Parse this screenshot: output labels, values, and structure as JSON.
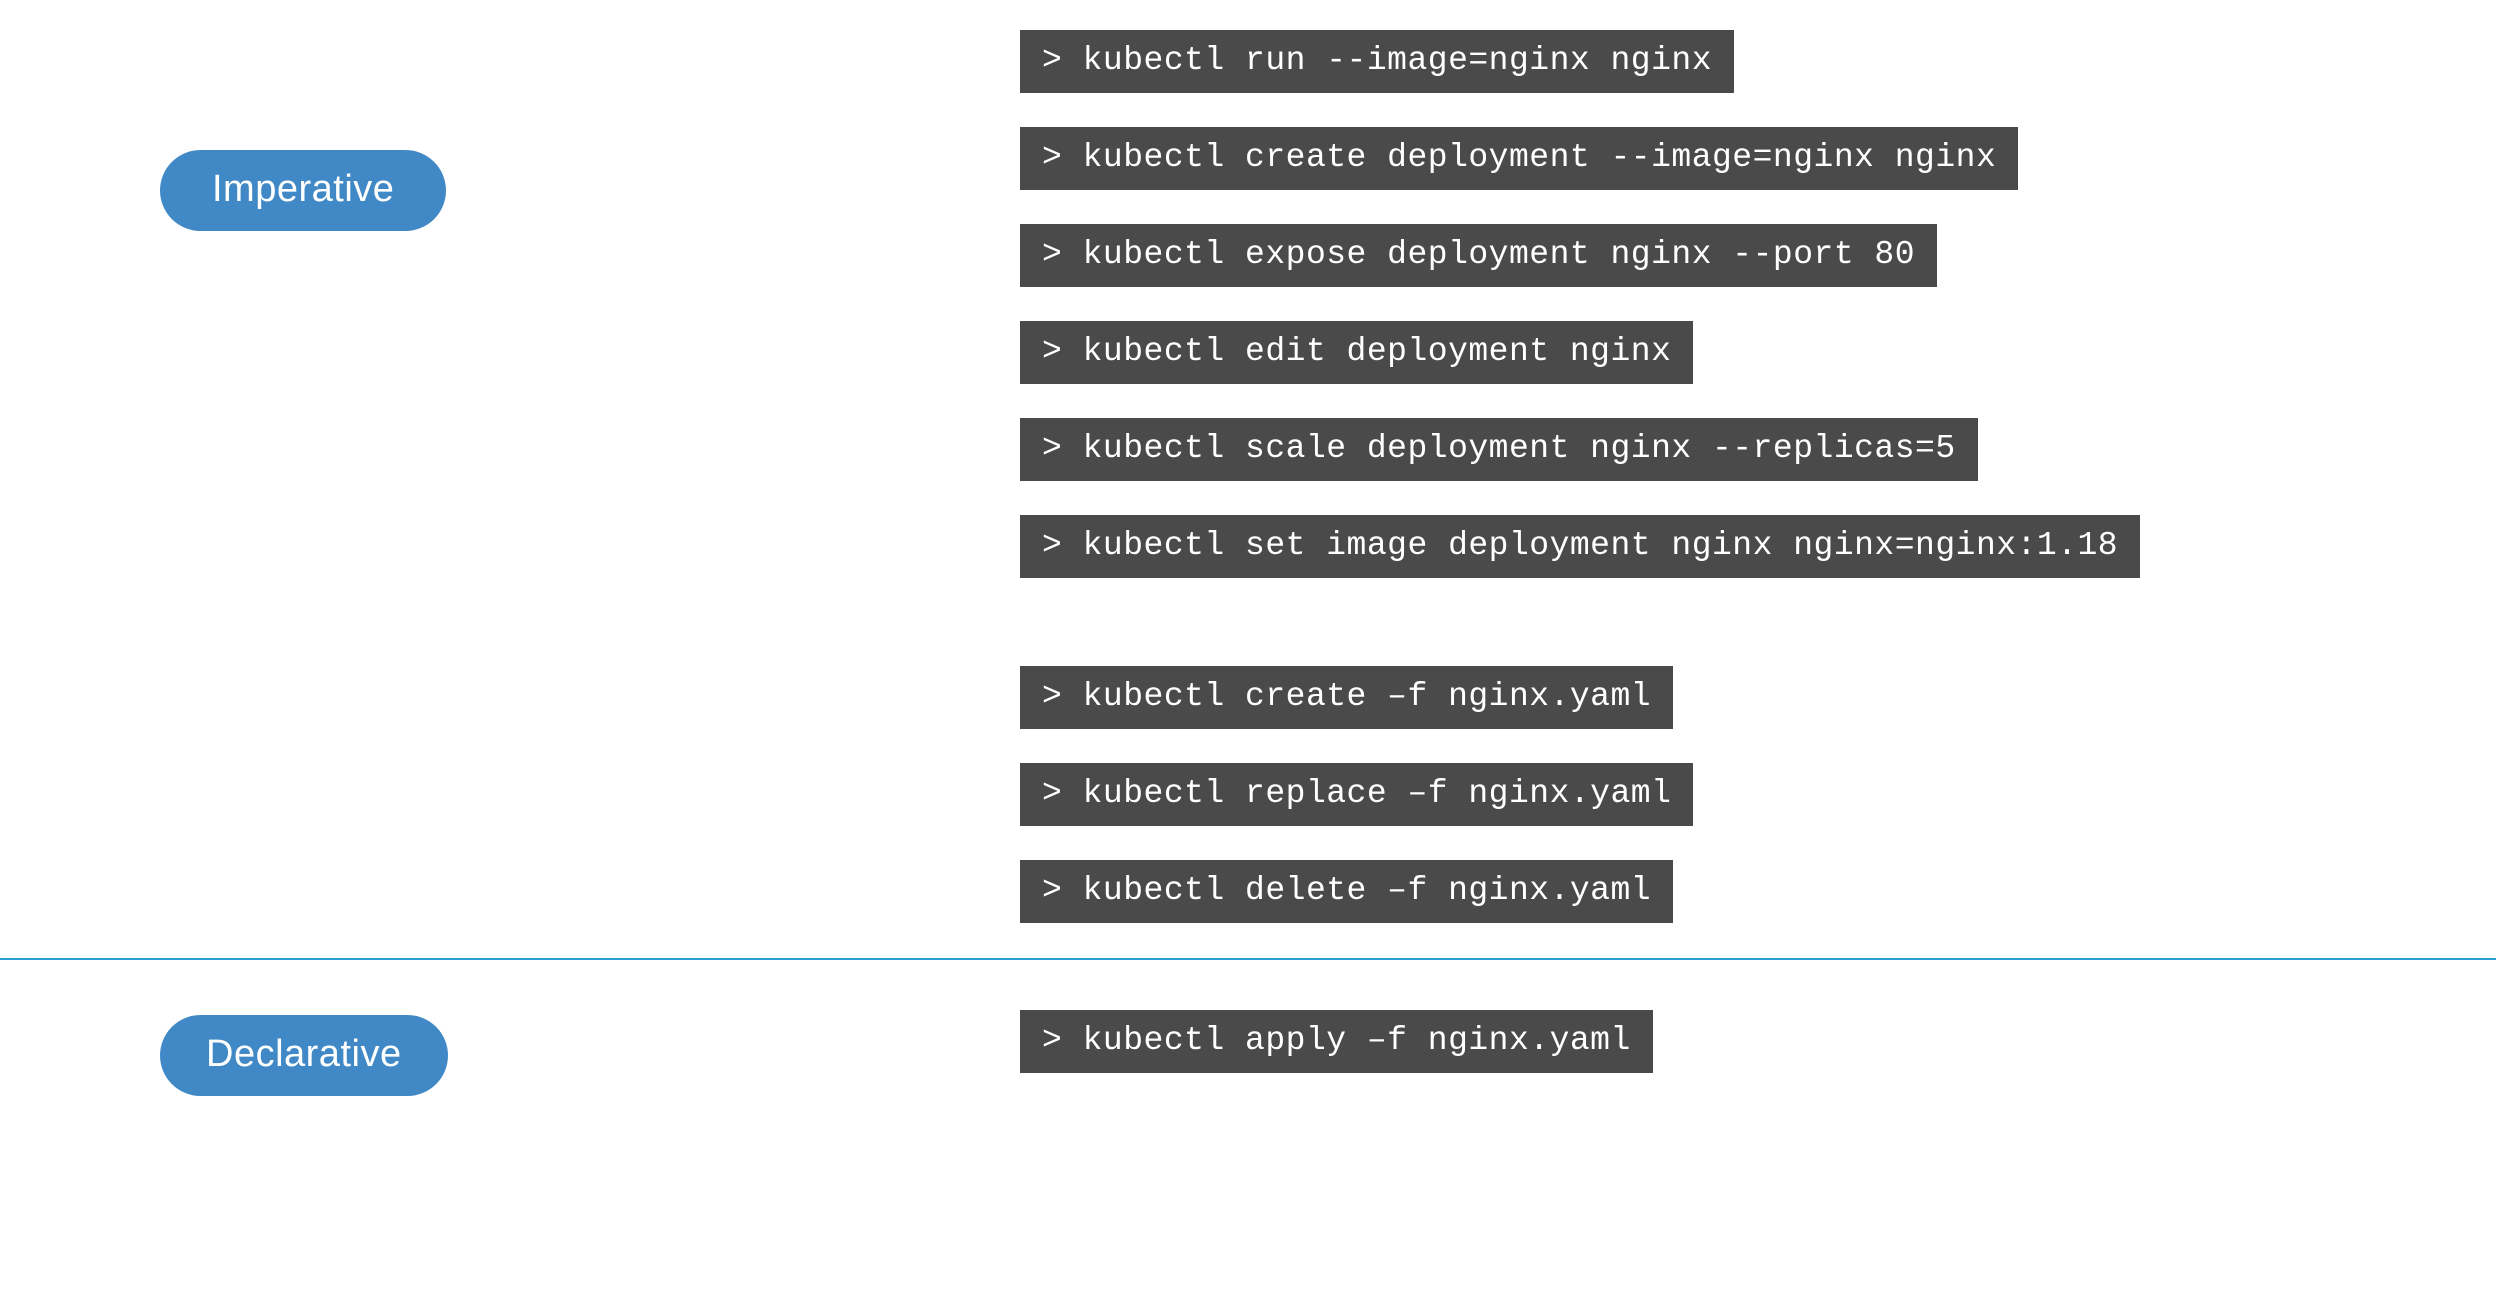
{
  "labels": {
    "imperative": "Imperative",
    "declarative": "Declarative"
  },
  "prompt": ">",
  "imperative_commands": [
    "kubectl run --image=nginx nginx",
    "kubectl create deployment --image=nginx nginx",
    "kubectl expose deployment nginx --port 80",
    "kubectl edit deployment nginx",
    "kubectl scale deployment nginx --replicas=5",
    "kubectl set image deployment nginx nginx=nginx:1.18",
    "kubectl create –f nginx.yaml",
    "kubectl replace –f nginx.yaml",
    "kubectl delete –f nginx.yaml"
  ],
  "declarative_commands": [
    "kubectl apply –f nginx.yaml"
  ],
  "colors": {
    "pill": "#4189C6",
    "divider": "#2a9fd6",
    "command_bg": "#4a4a4a",
    "command_fg": "#ffffff"
  }
}
